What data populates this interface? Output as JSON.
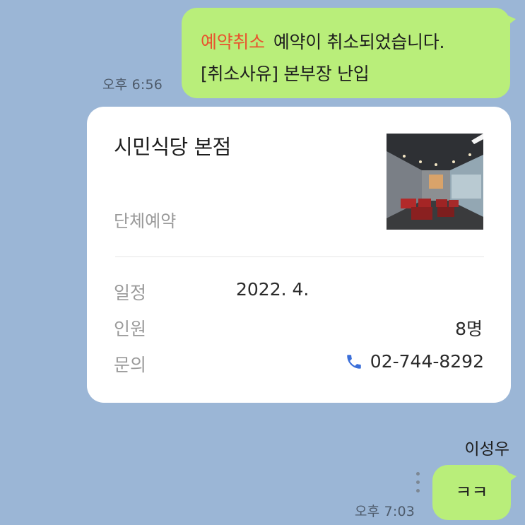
{
  "messages": {
    "cancel_notice": {
      "tag": "예약취소",
      "line1_text": "예약이 취소되었습니다.",
      "line2_text": "[취소사유] 본부장 난입",
      "time": "오후 6:56"
    },
    "reply": {
      "sender": "이성우",
      "text": "ㅋㅋ",
      "time": "오후 7:03"
    }
  },
  "card": {
    "title": "시민식당 본점",
    "subtitle": "단체예약",
    "rows": {
      "date": {
        "label": "일정",
        "value": "2022. 4."
      },
      "people": {
        "label": "인원",
        "value": "8명"
      },
      "contact": {
        "label": "문의",
        "value": "02-744-8292"
      }
    }
  },
  "colors": {
    "chat_background": "#9bb6d6",
    "my_bubble": "#b9ee7a",
    "cancel_tag": "#e8542e",
    "phone_icon": "#3b6fd9"
  },
  "icons": {
    "phone": "phone-icon",
    "more": "more-vertical-icon"
  }
}
